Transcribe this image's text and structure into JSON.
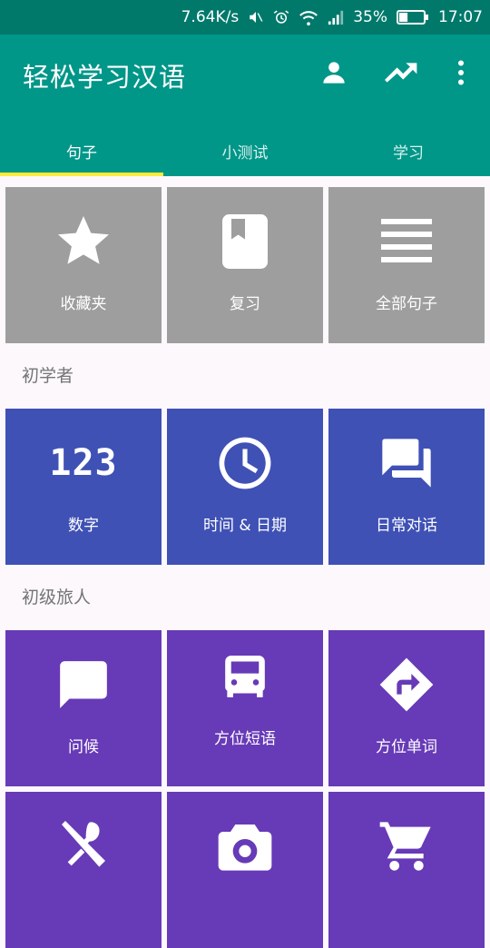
{
  "status_bar": {
    "speed": "7.64K/s",
    "battery_percent": "35%",
    "battery_level": 0.35,
    "time": "17:07",
    "icons": [
      "mute-icon",
      "alarm-icon",
      "wifi-icon",
      "signal-icon",
      "battery-icon"
    ]
  },
  "app_bar": {
    "title": "轻松学习汉语",
    "actions": [
      "account-icon",
      "trending-up-icon",
      "more-vert-icon"
    ]
  },
  "tabs": [
    {
      "label": "句子",
      "active": true
    },
    {
      "label": "小测试",
      "active": false
    },
    {
      "label": "学习",
      "active": false
    }
  ],
  "top_tiles": [
    {
      "label": "收藏夹",
      "icon": "star-icon"
    },
    {
      "label": "复习",
      "icon": "bookmark-book-icon"
    },
    {
      "label": "全部句子",
      "icon": "list-lines-icon"
    }
  ],
  "sections": [
    {
      "title": "初学者",
      "tiles": [
        {
          "label": "数字",
          "icon": "numbers-icon",
          "icon_text": "123"
        },
        {
          "label": "时间 & 日期",
          "icon": "clock-icon"
        },
        {
          "label": "日常对话",
          "icon": "chat-bubbles-icon"
        }
      ]
    },
    {
      "title": "初级旅人",
      "tiles": [
        {
          "label": "问候",
          "icon": "chat-bubble-icon"
        },
        {
          "label": "方位短语",
          "icon": "bus-icon"
        },
        {
          "label": "方位单词",
          "icon": "directions-icon"
        }
      ]
    }
  ],
  "partial_tiles": [
    "restaurant-icon",
    "camera-icon",
    "cart-icon"
  ],
  "colors": {
    "status_bar": "#00796b",
    "app_bar": "#009688",
    "tab_indicator": "#ffeb3b",
    "gray_tile": "#9e9e9e",
    "blue_tile": "#3f51b5",
    "purple_tile": "#673ab7",
    "background": "#fcf8fc"
  }
}
